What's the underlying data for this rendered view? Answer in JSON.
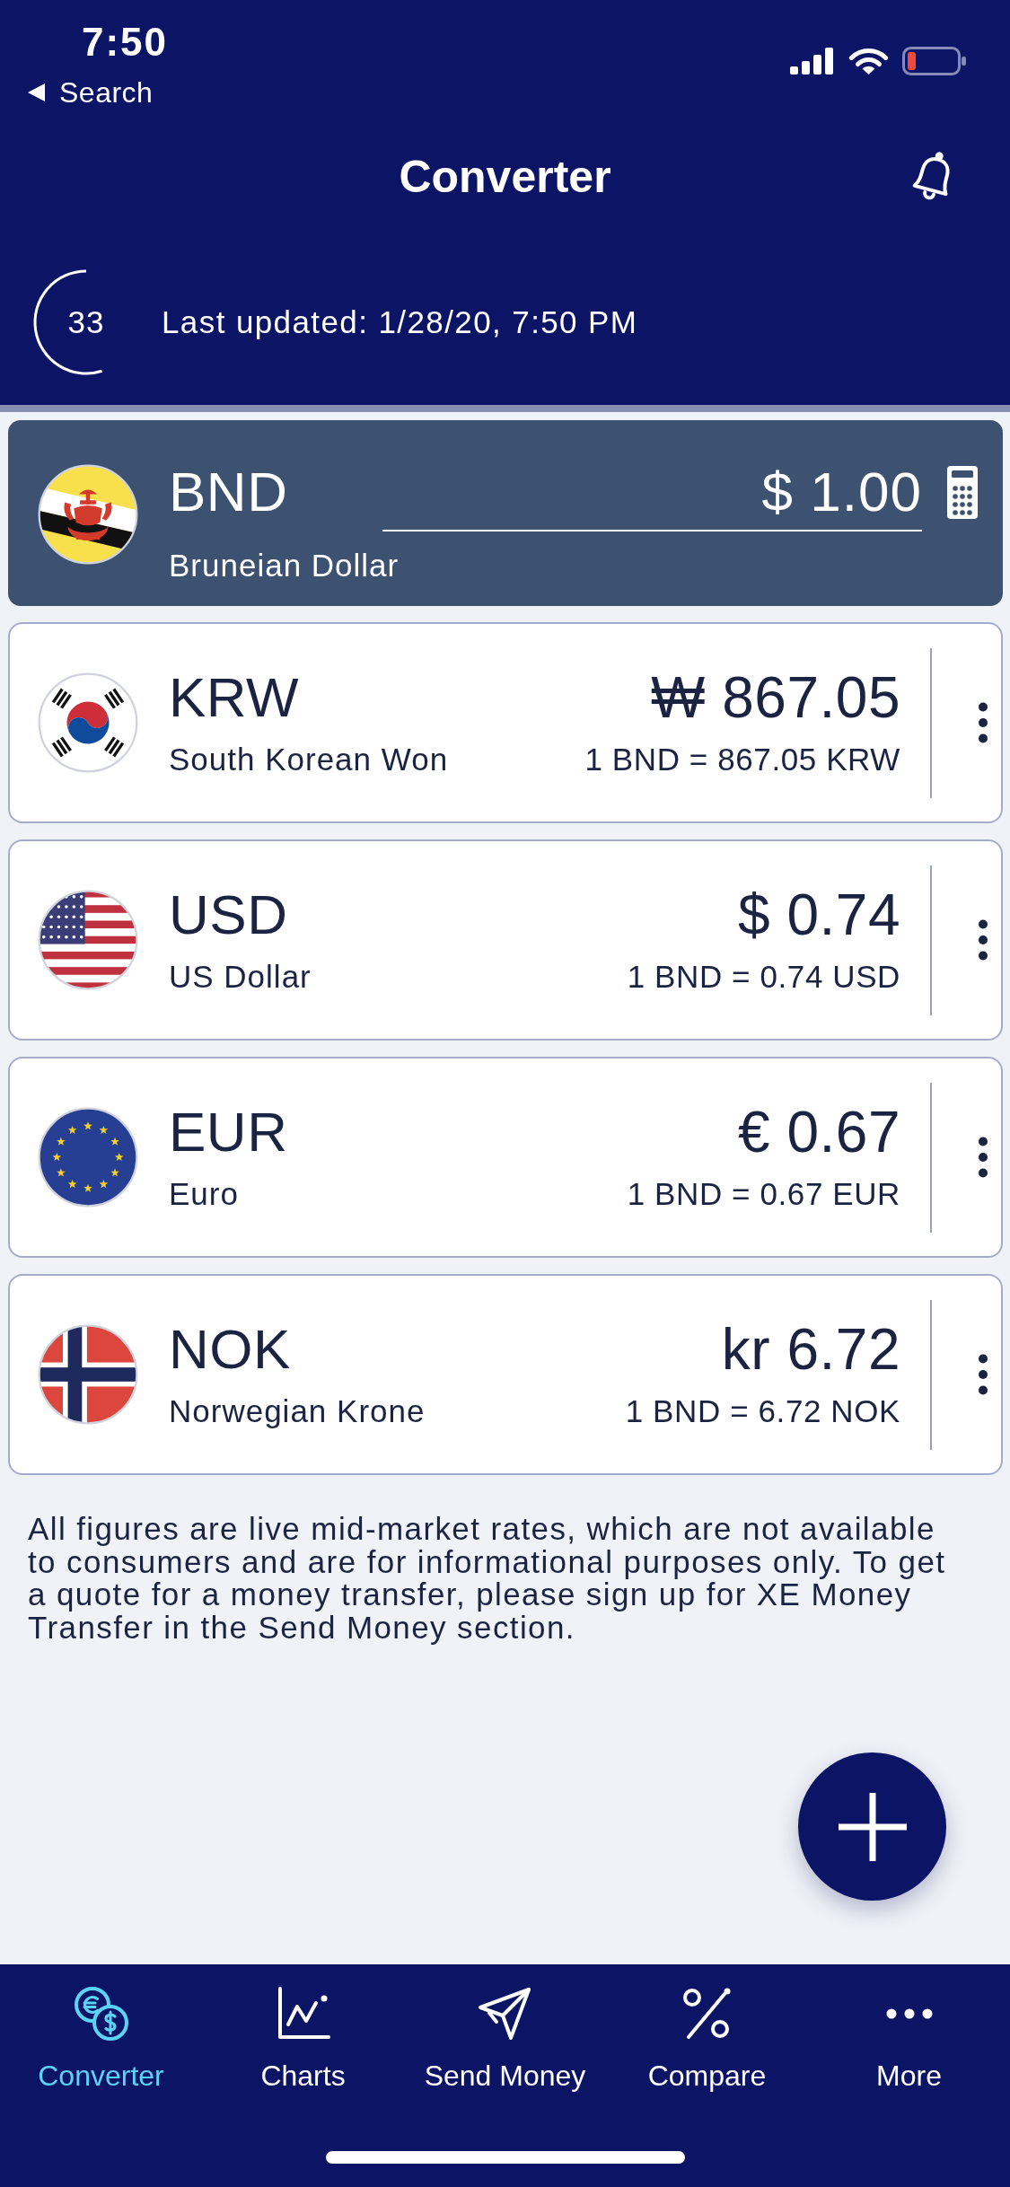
{
  "status_bar": {
    "time": "7:50",
    "back_label": "Search"
  },
  "header": {
    "title": "Converter"
  },
  "refresh": {
    "countdown": "33",
    "last_updated": "Last updated: 1/28/20, 7:50 PM"
  },
  "base_currency": {
    "code": "BND",
    "name": "Bruneian Dollar",
    "amount": "$ 1.00"
  },
  "currencies": [
    {
      "code": "KRW",
      "name": "South Korean Won",
      "amount": "₩ 867.05",
      "rate": "1 BND = 867.05 KRW"
    },
    {
      "code": "USD",
      "name": "US Dollar",
      "amount": "$ 0.74",
      "rate": "1 BND = 0.74 USD"
    },
    {
      "code": "EUR",
      "name": "Euro",
      "amount": "€ 0.67",
      "rate": "1 BND = 0.67 EUR"
    },
    {
      "code": "NOK",
      "name": "Norwegian Krone",
      "amount": "kr 6.72",
      "rate": "1 BND = 6.72 NOK"
    }
  ],
  "disclaimer": "All figures are live mid-market rates, which are not available to consumers and are for informational purposes only. To get a quote for a money transfer, please sign up for XE Money Transfer in the Send Money section.",
  "tab_bar": [
    {
      "label": "Converter",
      "selected": true
    },
    {
      "label": "Charts",
      "selected": false
    },
    {
      "label": "Send Money",
      "selected": false
    },
    {
      "label": "Compare",
      "selected": false
    },
    {
      "label": "More",
      "selected": false
    }
  ]
}
